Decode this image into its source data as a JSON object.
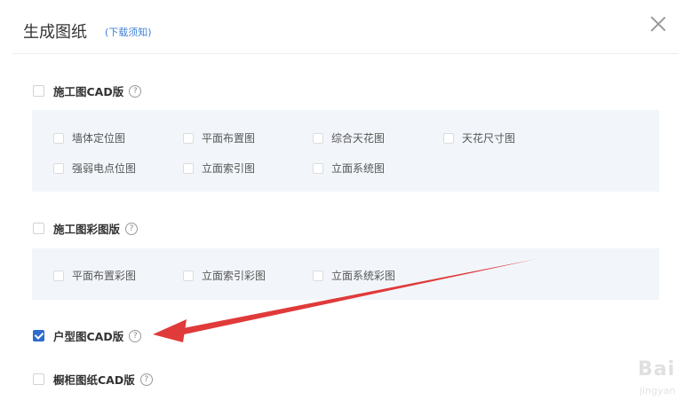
{
  "dialog": {
    "title": "生成图纸",
    "title_link": "(下载须知)",
    "close_icon": "close-icon"
  },
  "sections": [
    {
      "label": "施工图CAD版",
      "checked": false,
      "options": [
        "墙体定位图",
        "平面布置图",
        "综合天花图",
        "天花尺寸图",
        "强弱电点位图",
        "立面索引图",
        "立面系统图"
      ]
    },
    {
      "label": "施工图彩图版",
      "checked": false,
      "options": [
        "平面布置彩图",
        "立面索引彩图",
        "立面系统彩图"
      ]
    },
    {
      "label": "户型图CAD版",
      "checked": true,
      "options": []
    },
    {
      "label": "橱柜图纸CAD版",
      "checked": false,
      "options": []
    }
  ],
  "help_icon_glyph": "?",
  "annotation": {
    "arrow_color": "#e03a3a"
  },
  "watermark": {
    "big": "Bai",
    "small": "jingyan"
  },
  "colors": {
    "accent": "#2d6bcf",
    "link": "#3d7fd6",
    "panel_bg": "#f2f6fb"
  }
}
